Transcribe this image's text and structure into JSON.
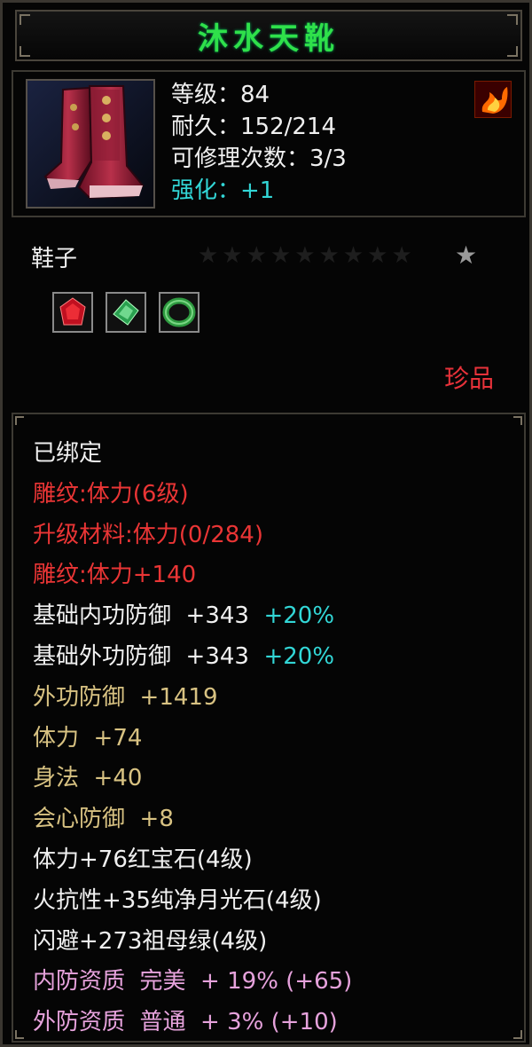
{
  "item": {
    "name": "沐水天靴",
    "type": "鞋子",
    "rarity": "珍品",
    "stars_total": 9,
    "stars_filled": 1
  },
  "stats": {
    "level": "等级：84",
    "durability": "耐久：152/214",
    "repairs": "可修理次数：3/3",
    "enhance": "强化：+1"
  },
  "gems": [
    {
      "icon": "red-gem-icon",
      "color": "#d01818"
    },
    {
      "icon": "green-gem-icon",
      "color": "#38c060"
    },
    {
      "icon": "green-ring-gem-icon",
      "color": "#3aa048"
    }
  ],
  "attributes": {
    "bound": "已绑定",
    "engrave": "雕纹:体力(6级)",
    "upgrade_material": "升级材料:体力(0/284)",
    "engrave_bonus": "雕纹:体力+140",
    "inner_def_label": "基础内功防御  +343",
    "inner_def_pct": "+20%",
    "outer_def_label": "基础外功防御  +343",
    "outer_def_pct": "+20%",
    "ext_def": "外功防御  +1419",
    "vitality": "体力  +74",
    "agility": "身法  +40",
    "crit_def": "会心防御  +8",
    "gem1": "体力+76红宝石(4级)",
    "gem2": "火抗性+35纯净月光石(4级)",
    "gem3": "闪避+273祖母绿(4级)",
    "inner_quality": "内防资质  完美  + 19% (+65)",
    "outer_quality": "外防资质  普通  + 3% (+10)"
  }
}
